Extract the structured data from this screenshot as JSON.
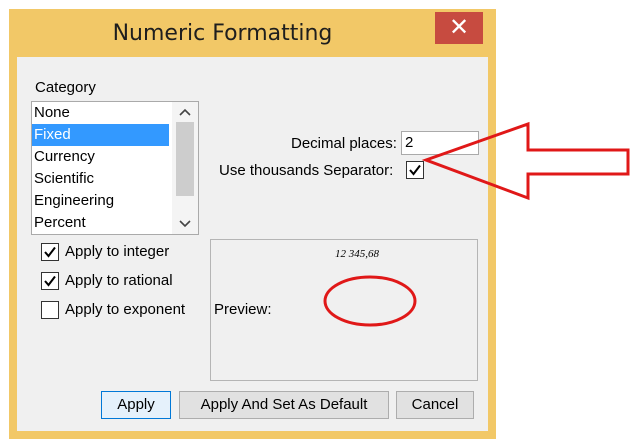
{
  "window": {
    "title": "Numeric Formatting",
    "close_glyph": "✕"
  },
  "category": {
    "label": "Category",
    "items": [
      "None",
      "Fixed",
      "Currency",
      "Scientific",
      "Engineering",
      "Percent"
    ],
    "selected": "Fixed"
  },
  "format": {
    "decimal_label": "Decimal places:",
    "decimal_value": "2",
    "thousands_label": "Use thousands Separator:",
    "thousands_checked": true
  },
  "options": {
    "integer_label": "Apply to integer",
    "integer_checked": true,
    "rational_label": "Apply to rational",
    "rational_checked": true,
    "exponent_label": "Apply to exponent",
    "exponent_checked": false
  },
  "preview": {
    "label": "Preview:",
    "value": "12 345,68"
  },
  "buttons": {
    "apply": "Apply",
    "apply_default": "Apply And Set As Default",
    "cancel": "Cancel"
  },
  "annotation": {
    "color": "#e01818"
  }
}
